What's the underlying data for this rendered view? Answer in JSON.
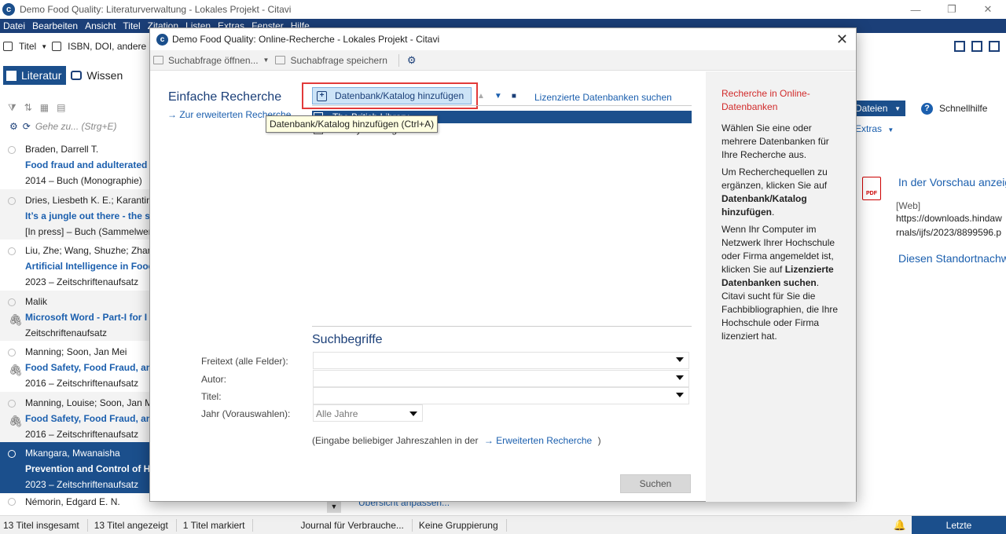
{
  "main_window": {
    "title": "Demo Food Quality: Literaturverwaltung - Lokales Projekt - Citavi",
    "menu": [
      "Datei",
      "Bearbeiten",
      "Ansicht",
      "Titel",
      "Zitation",
      "Listen",
      "Extras",
      "Fenster",
      "Hilfe"
    ],
    "toolbar": {
      "titel_label": "Titel",
      "isbn_label": "ISBN, DOI, andere I"
    },
    "nav": {
      "literatur": "Literatur",
      "wissen": "Wissen"
    },
    "search_placeholder": "Gehe zu... (Strg+E)",
    "references": [
      {
        "author": "Braden, Darrell T.",
        "title": "Food fraud and adulterated",
        "meta": "2014 – Buch (Monographie)",
        "clip": false,
        "selected": false
      },
      {
        "author": "Dries, Liesbeth K. E.; Karantinin",
        "title": "It’s a jungle out there - the s",
        "meta": "[In press] – Buch (Sammelwerk",
        "clip": false,
        "selected": false
      },
      {
        "author": "Liu, Zhe; Wang, Shuzhe; Zhang",
        "title": "Artificial Intelligence in Food",
        "meta": "2023 – Zeitschriftenaufsatz",
        "clip": false,
        "selected": false
      },
      {
        "author": "Malik",
        "title": "Microsoft Word - Part-I for I",
        "meta": "Zeitschriftenaufsatz",
        "clip": true,
        "selected": false
      },
      {
        "author": "Manning; Soon, Jan Mei",
        "title": "Food Safety, Food Fraud, an",
        "meta": "2016 – Zeitschriftenaufsatz",
        "clip": true,
        "selected": false
      },
      {
        "author": "Manning, Louise; Soon, Jan M",
        "title": "Food Safety, Food Fraud, an",
        "meta": "2016 – Zeitschriftenaufsatz",
        "clip": true,
        "selected": false
      },
      {
        "author": "Mkangara, Mwanaisha",
        "title": "Prevention and Control of H",
        "meta": "2023 – Zeitschriftenaufsatz",
        "clip": false,
        "selected": true
      }
    ],
    "last_reference_author": "Némorin, Edgard E. N.",
    "right_pane": {
      "dateien": "Dateien",
      "schnellhilfe": "Schnellhilfe",
      "extras": "Extras",
      "preview_link": "In der Vorschau anzeig",
      "web_tag": "[Web]",
      "url_line1": "https://downloads.hindaw",
      "url_line2": "rnals/ijfs/2023/8899596.p",
      "standort": "Diesen Standortnachw"
    },
    "ubersicht": "Übersicht anpassen...",
    "status": {
      "total": "13 Titel insgesamt",
      "shown": "13 Titel angezeigt",
      "marked": "1 Titel markiert",
      "journal": "Journal für Verbrauche...",
      "grouping": "Keine Gruppierung",
      "recent": "Letzte Änderungen"
    }
  },
  "dialog": {
    "title": "Demo Food Quality: Online-Recherche - Lokales Projekt - Citavi",
    "toolbar": {
      "open_query": "Suchabfrage öffnen...",
      "save_query": "Suchabfrage speichern"
    },
    "heading": "Einfache Recherche",
    "advanced_link": "Zur erweiterten Recherche",
    "add_db_button": "Datenbank/Katalog hinzufügen",
    "licensed_link": "Lizenzierte Datenbanken suchen",
    "tooltip": "Datenbank/Katalog hinzufügen (Ctrl+A)",
    "databases": [
      {
        "label": "The British Library",
        "checked": false,
        "selected": true
      },
      {
        "label": "Library of Congress",
        "checked": false,
        "selected": false
      }
    ],
    "search_terms_heading": "Suchbegriffe",
    "fields": {
      "freitext": "Freitext (alle Felder):",
      "autor": "Autor:",
      "titel": "Titel:",
      "jahr": "Jahr (Vorauswahlen):"
    },
    "jahr_value": "Alle Jahre",
    "hint_prefix": "(Eingabe beliebiger Jahreszahlen in der",
    "hint_link": "Erweiterten Recherche",
    "hint_suffix": ")",
    "search_button": "Suchen",
    "help": {
      "heading": "Recherche in Online-Datenbanken",
      "p1": "Wählen Sie eine oder mehrere Datenbanken für Ihre Recherche aus.",
      "p2_pre": "Um Recherchequellen zu ergänzen, klicken Sie auf ",
      "p2_bold": "Datenbank/Katalog hinzufügen",
      "p2_post": ".",
      "p3_pre": "Wenn Ihr Computer im Netzwerk Ihrer Hochschule oder Firma angemeldet ist, klicken Sie auf ",
      "p3_bold": "Lizenzierte Datenbanken suchen",
      "p3_post": ". Citavi sucht für Sie die Fachbibliographien, die Ihre Hochschule oder Firma lizenziert hat."
    }
  },
  "colors": {
    "brand": "#1b4f8c",
    "menubar": "#1b3f78",
    "link": "#1b5fae",
    "highlight_frame": "#e23a3a",
    "help_heading": "#d12b2b"
  }
}
